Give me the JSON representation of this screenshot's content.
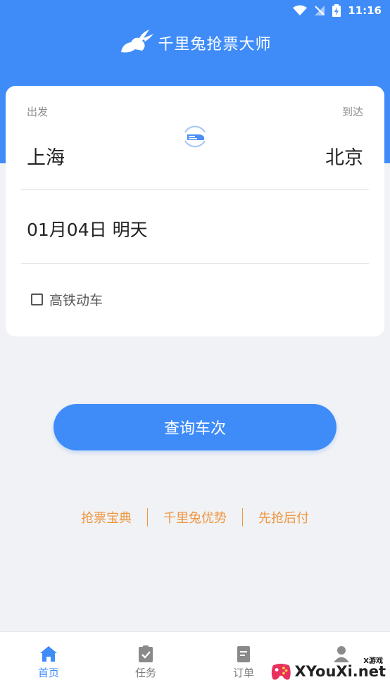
{
  "status_bar": {
    "time": "11:16"
  },
  "app": {
    "title": "千里兔抢票大师"
  },
  "search": {
    "depart_label": "出发",
    "arrive_label": "到达",
    "depart_city": "上海",
    "arrive_city": "北京",
    "date": "01月04日 明天",
    "high_speed_label": "高铁动车",
    "high_speed_checked": false
  },
  "query_button": "查询车次",
  "links": [
    "抢票宝典",
    "千里兔优势",
    "先抢后付"
  ],
  "tabs": [
    {
      "label": "首页",
      "icon": "home-icon",
      "active": true
    },
    {
      "label": "任务",
      "icon": "task-icon",
      "active": false
    },
    {
      "label": "订单",
      "icon": "order-icon",
      "active": false
    }
  ],
  "watermark": {
    "text": "XYouXi.net",
    "tag": "X游戏"
  },
  "colors": {
    "primary": "#3f8cf9",
    "link": "#f0963f",
    "background": "#f0f2f5",
    "tab_inactive": "#7a7a7a"
  }
}
